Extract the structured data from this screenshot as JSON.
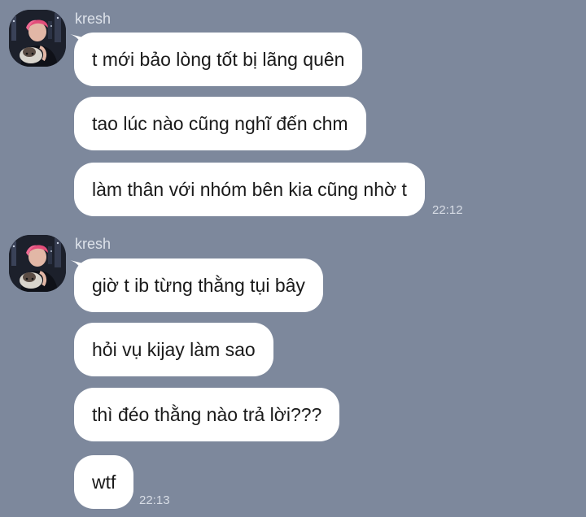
{
  "conversation": {
    "groups": [
      {
        "sender": "kresh",
        "avatar_icon": "user-avatar-photo",
        "messages": [
          "t mới bảo lòng tốt bị lãng quên",
          "tao lúc nào cũng nghĩ đến chm",
          "làm thân với nhóm bên kia cũng nhờ t"
        ],
        "time": "22:12"
      },
      {
        "sender": "kresh",
        "avatar_icon": "user-avatar-photo",
        "messages": [
          "giờ t ib từng thằng tụi bây",
          "hỏi vụ kijay làm sao",
          "thì đéo thằng nào trả lời???",
          "wtf"
        ],
        "time": "22:13"
      }
    ]
  },
  "colors": {
    "background": "#7d889c",
    "bubble": "#ffffff",
    "bubble_text": "#1a1a1a",
    "meta_text": "#dde2ea"
  }
}
